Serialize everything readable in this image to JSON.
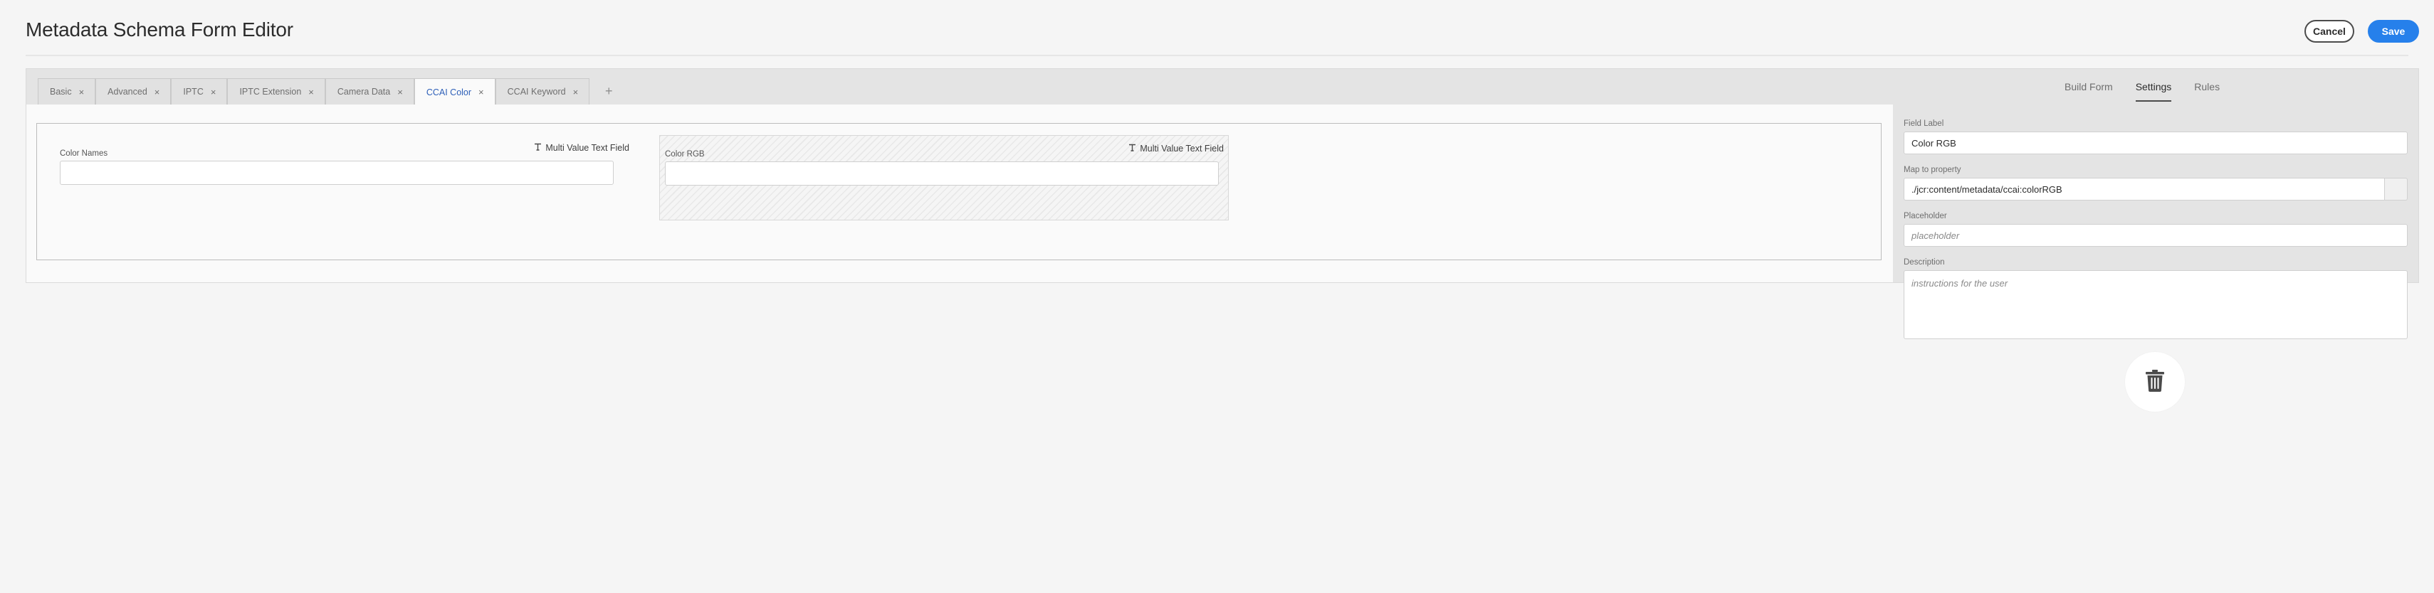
{
  "header": {
    "title": "Metadata Schema Form Editor",
    "cancel_label": "Cancel",
    "save_label": "Save"
  },
  "tabs": [
    {
      "label": "Basic",
      "close": "×"
    },
    {
      "label": "Advanced",
      "close": "×"
    },
    {
      "label": "IPTC",
      "close": "×"
    },
    {
      "label": "IPTC Extension",
      "close": "×"
    },
    {
      "label": "Camera Data",
      "close": "×"
    },
    {
      "label": "CCAI Color",
      "close": "×",
      "active": true
    },
    {
      "label": "CCAI Keyword",
      "close": "×"
    }
  ],
  "add_tab_label": "+",
  "fields": [
    {
      "label": "Color Names",
      "type": "Multi Value Text Field",
      "type_icon": "text-field-icon",
      "selected": false
    },
    {
      "label": "Color RGB",
      "type": "Multi Value Text Field",
      "type_icon": "text-field-icon",
      "selected": true
    }
  ],
  "config_tabs": [
    {
      "label": "Build Form"
    },
    {
      "label": "Settings",
      "active": true
    },
    {
      "label": "Rules"
    }
  ],
  "settings": {
    "field_label_label": "Field Label",
    "field_label_value": "Color RGB",
    "map_label": "Map to property",
    "map_value": "./jcr:content/metadata/ccai:colorRGB",
    "placeholder_label": "Placeholder",
    "placeholder_value": "placeholder",
    "description_label": "Description",
    "description_value": "instructions for the user"
  },
  "delete_icon": "trash-icon",
  "colors": {
    "accent": "#2680eb",
    "active_tab_text": "#2d5fb8",
    "background": "#f5f5f5",
    "panel": "#e4e4e4"
  }
}
